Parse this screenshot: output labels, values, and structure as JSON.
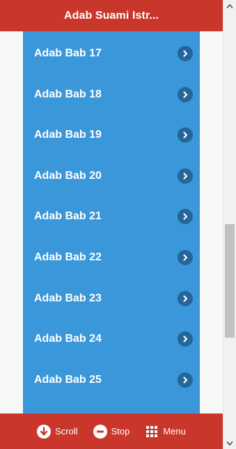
{
  "header": {
    "title": "Adab Suami Istr..."
  },
  "list": {
    "items": [
      {
        "label": "Adab Bab 17"
      },
      {
        "label": "Adab Bab 18"
      },
      {
        "label": "Adab Bab 19"
      },
      {
        "label": "Adab Bab 20"
      },
      {
        "label": "Adab Bab 21"
      },
      {
        "label": "Adab Bab 22"
      },
      {
        "label": "Adab Bab 23"
      },
      {
        "label": "Adab Bab 24"
      },
      {
        "label": "Adab Bab 25"
      }
    ]
  },
  "footer": {
    "scroll_label": "Scroll",
    "stop_label": "Stop",
    "menu_label": "Menu"
  },
  "colors": {
    "bar_red": "#c9372c",
    "list_blue": "#3a97d9",
    "chevron_dark_blue": "#25659a"
  },
  "icons": {
    "item_icon": "chevron-right-circle-icon",
    "scroll": "arrow-down-circle-icon",
    "stop": "minus-circle-icon",
    "menu": "grid-icon"
  }
}
